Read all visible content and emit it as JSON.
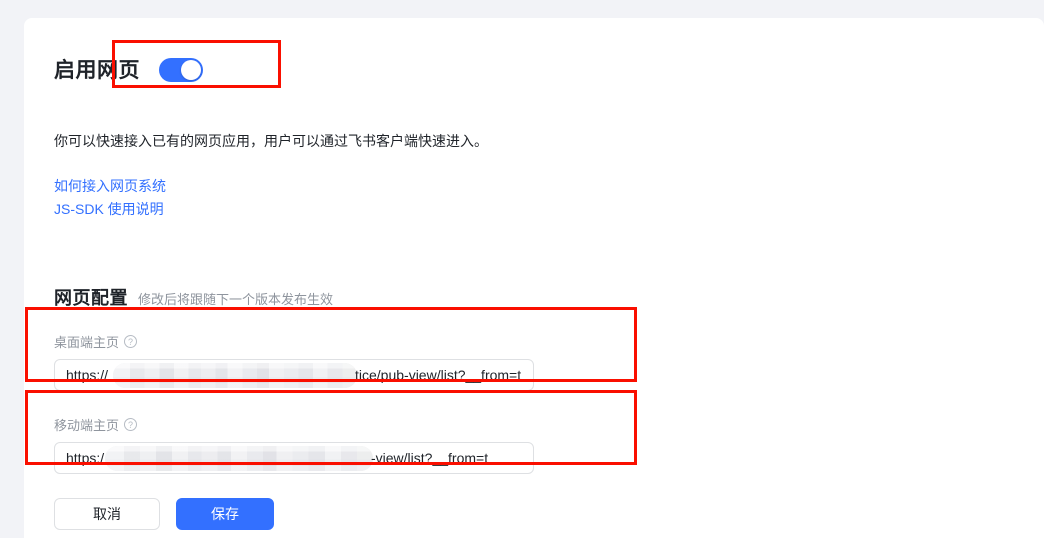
{
  "page": {
    "title": "启用网页",
    "description": "你可以快速接入已有的网页应用，用户可以通过飞书客户端快速进入。"
  },
  "toggle": {
    "state": "on",
    "color": "#3370ff"
  },
  "links": [
    {
      "label": "如何接入网页系统"
    },
    {
      "label": "JS-SDK 使用说明"
    }
  ],
  "section": {
    "title": "网页配置",
    "subtitle": "修改后将跟随下一个版本发布生效"
  },
  "fields": [
    {
      "label": "桌面端主页",
      "help_icon": "question-circle-icon",
      "value_prefix": "https://",
      "value_redacted": true,
      "value_suffix": "tice/pub-view/list?__from=t"
    },
    {
      "label": "移动端主页",
      "help_icon": "question-circle-icon",
      "value_prefix": "https:/",
      "value_redacted": true,
      "value_suffix": "-view/list?__from=t"
    }
  ],
  "actions": {
    "cancel_label": "取消",
    "save_label": "保存",
    "save_color": "#3370ff"
  },
  "annotations": {
    "color": "#fa0f00",
    "boxes": [
      "enable-toggle",
      "desktop-homepage-field",
      "mobile-homepage-field"
    ]
  }
}
